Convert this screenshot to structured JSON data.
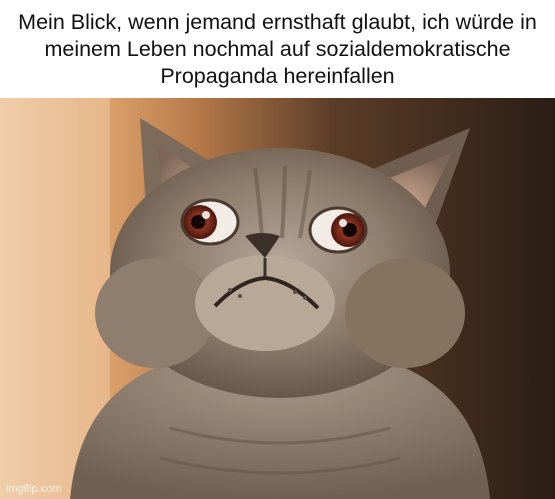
{
  "caption": {
    "text": "Mein Blick, wenn jemand ernsthaft glaubt, ich würde in meinem Leben nochmal auf sozialdemokratische Propaganda hereinfallen"
  },
  "watermark": {
    "text": "imgflip.com"
  },
  "photo": {
    "subject": "surprised-gray-cat",
    "colors": {
      "fur": "#8d7b6b",
      "fur_light": "#b4a597",
      "fur_dark": "#5e5044",
      "background_left": "#e8c4a0",
      "background_right": "#3a2a1e",
      "eye_iris": "#7a2e1c"
    }
  }
}
